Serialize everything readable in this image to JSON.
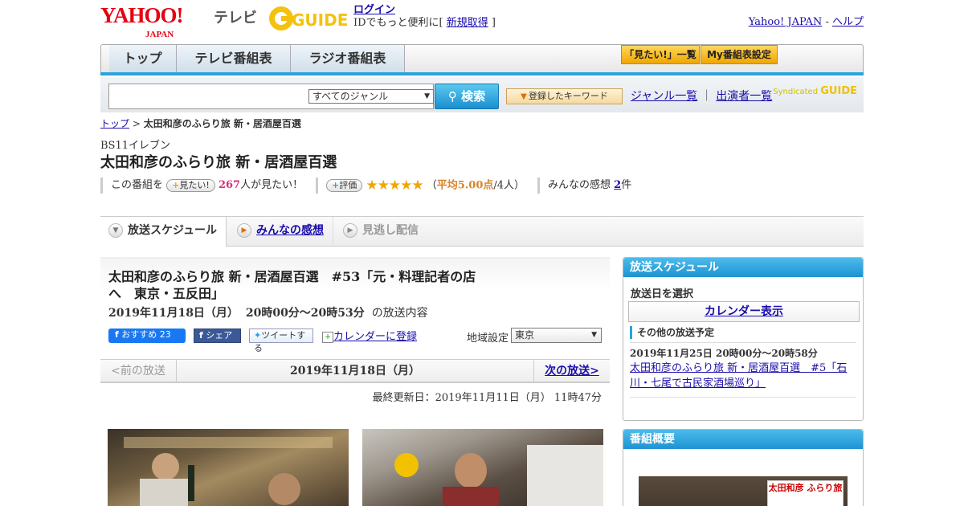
{
  "header": {
    "yahoo_logo": "YAHOO!",
    "yahoo_sub": "JAPAN",
    "tv_label": "テレビ",
    "gguide_logo": "G-GUIDE",
    "login_link": "ログイン",
    "login_text_pre": "IDでもっと便利に[ ",
    "signup_link": "新規取得",
    "login_text_post": " ]",
    "yahoo_japan_link": "Yahoo! JAPAN",
    "separator": " - ",
    "help_link": "ヘルプ"
  },
  "nav": {
    "tabs": [
      {
        "label": "トップ"
      },
      {
        "label": "テレビ番組表"
      },
      {
        "label": "ラジオ番組表"
      }
    ],
    "mitai_list": "「見たい!」一覧",
    "my_schedule": "My番組表設定"
  },
  "search": {
    "placeholder": "",
    "genre": "すべてのジャンル",
    "button": "検索",
    "keyword_button": "登録したキーワード",
    "genre_list_link": "ジャンル一覧",
    "divider": "｜",
    "performer_list_link": "出演者一覧",
    "syndicated": "Syndicated",
    "syndicated_logo": "GUIDE"
  },
  "breadcrumb": {
    "top_link": "トップ",
    "sep": " > ",
    "current": "太田和彦のふらり旅 新・居酒屋百選"
  },
  "program": {
    "channel": "BS11イレブン",
    "title": "太田和彦のふらり旅 新・居酒屋百選",
    "mitai_pre": "この番組を",
    "mitai_btn": "見たい!",
    "mitai_count": "267",
    "mitai_post": "人が見たい！",
    "rating_btn": "評価",
    "stars": "★★★★★",
    "avg_pre": "（",
    "avg": "平均5.00点",
    "avg_post": "/4人）",
    "impressions_label": "みんなの感想",
    "impressions_count": "2",
    "impressions_unit": "件"
  },
  "tabs": {
    "schedule": "放送スケジュール",
    "impressions": "みんなの感想",
    "missed": "見逃し配信"
  },
  "episode": {
    "title": "太田和彦のふらり旅 新・居酒屋百選　#53「元・料理記者の店へ　東京・五反田」",
    "date": "2019年11月18日（月）",
    "time": "20時00分～20時53分",
    "date_suffix": "の放送内容",
    "fb_recommend": "おすすめ 23",
    "fb_share": "シェア",
    "tweet": "ツイートする",
    "calendar_register": "カレンダーに登録",
    "region_label": "地域設定",
    "region_value": "東京",
    "prev": "<前の放送",
    "current_date": "2019年11月18日（月）",
    "next": "次の放送>",
    "updated": "最終更新日：2019年11月11日（月） 11時47分"
  },
  "side": {
    "schedule_head": "放送スケジュール",
    "select_date": "放送日を選択",
    "calendar_btn": "カレンダー表示",
    "other_head": "その他の放送予定",
    "other_date": "2019年11月25日  20時00分～20時58分",
    "other_title": "太田和彦のふらり旅 新・居酒屋百選　#5「石川・七尾で古民家酒場巡り」",
    "overview_head": "番組概要",
    "overview_sign": "太田和彦 ふらり旅"
  },
  "colors": {
    "accent_blue": "#2aa3dc",
    "yahoo_red": "#e60012",
    "star_orange": "#f2a500",
    "mitai_pink": "#d9307a"
  }
}
